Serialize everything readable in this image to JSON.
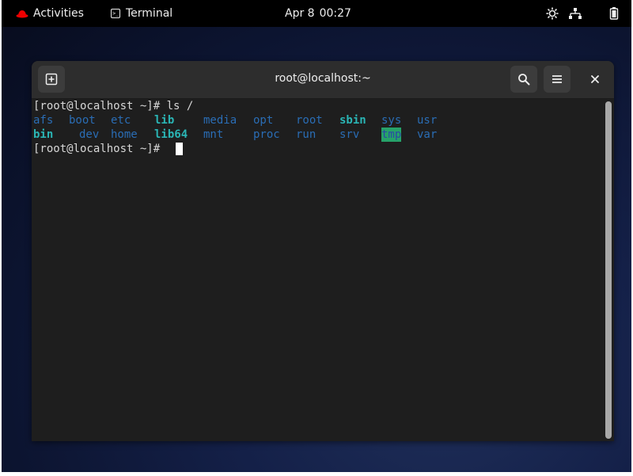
{
  "topbar": {
    "activities_label": "Activities",
    "app_menu_label": "Terminal",
    "clock_date": "Apr 8",
    "clock_time": "00:27",
    "status_icons": [
      "brightness-icon",
      "network-icon",
      "battery-icon"
    ]
  },
  "window": {
    "title": "root@localhost:~",
    "buttons": [
      "new-tab-icon",
      "search-icon",
      "hamburger-menu-icon",
      "close-icon"
    ]
  },
  "terminal": {
    "prompt1": "[root@localhost ~]# ls /",
    "ls_row1": [
      "afs",
      "boot",
      "etc",
      "lib",
      "media",
      "opt",
      "root",
      "sbin",
      "sys",
      "usr"
    ],
    "ls_row2": [
      "bin",
      "dev",
      "home",
      "lib64",
      "mnt",
      "proc",
      "run",
      "srv",
      "tmp",
      "var"
    ],
    "prompt2": "[root@localhost ~]# "
  },
  "colors": {
    "directory": "#2a6db5",
    "symlink": "#2ab5b5",
    "sticky_dir_bg": "#26a269",
    "terminal_bg": "#1e1e1e",
    "headerbar_bg": "#2d2d2d",
    "topbar_bg": "#000000"
  }
}
